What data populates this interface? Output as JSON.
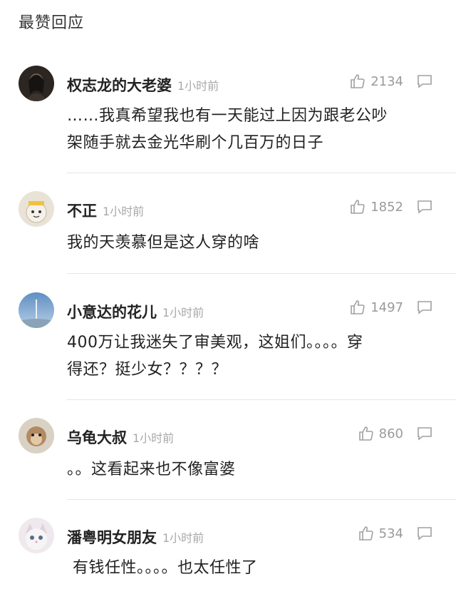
{
  "section_title": "最赞回应",
  "comments": [
    {
      "username": "权志龙的大老婆",
      "time": "1小时前",
      "likes": "2134",
      "avatar": "dark-portrait",
      "content": "……我真希望我也有一天能过上因为跟老公吵\n架随手就去金光华刷个几百万的日子"
    },
    {
      "username": "不正",
      "time": "1小时前",
      "likes": "1852",
      "avatar": "cartoon-face",
      "content": "我的天羡慕但是这人穿的啥"
    },
    {
      "username": "小意达的花儿",
      "time": "1小时前",
      "likes": "1497",
      "avatar": "sky-tower",
      "content": "400万让我迷失了审美观，这姐们。。。。穿\n得还？挺少女？？？？"
    },
    {
      "username": "乌龟大叔",
      "time": "1小时前",
      "likes": "860",
      "avatar": "monkey-photo",
      "content": "。。这看起来也不像富婆"
    },
    {
      "username": "潘粤明女朋友",
      "time": "1小时前",
      "likes": "534",
      "avatar": "kitten-photo",
      "content": "有钱任性。。。。也太任性了"
    }
  ]
}
